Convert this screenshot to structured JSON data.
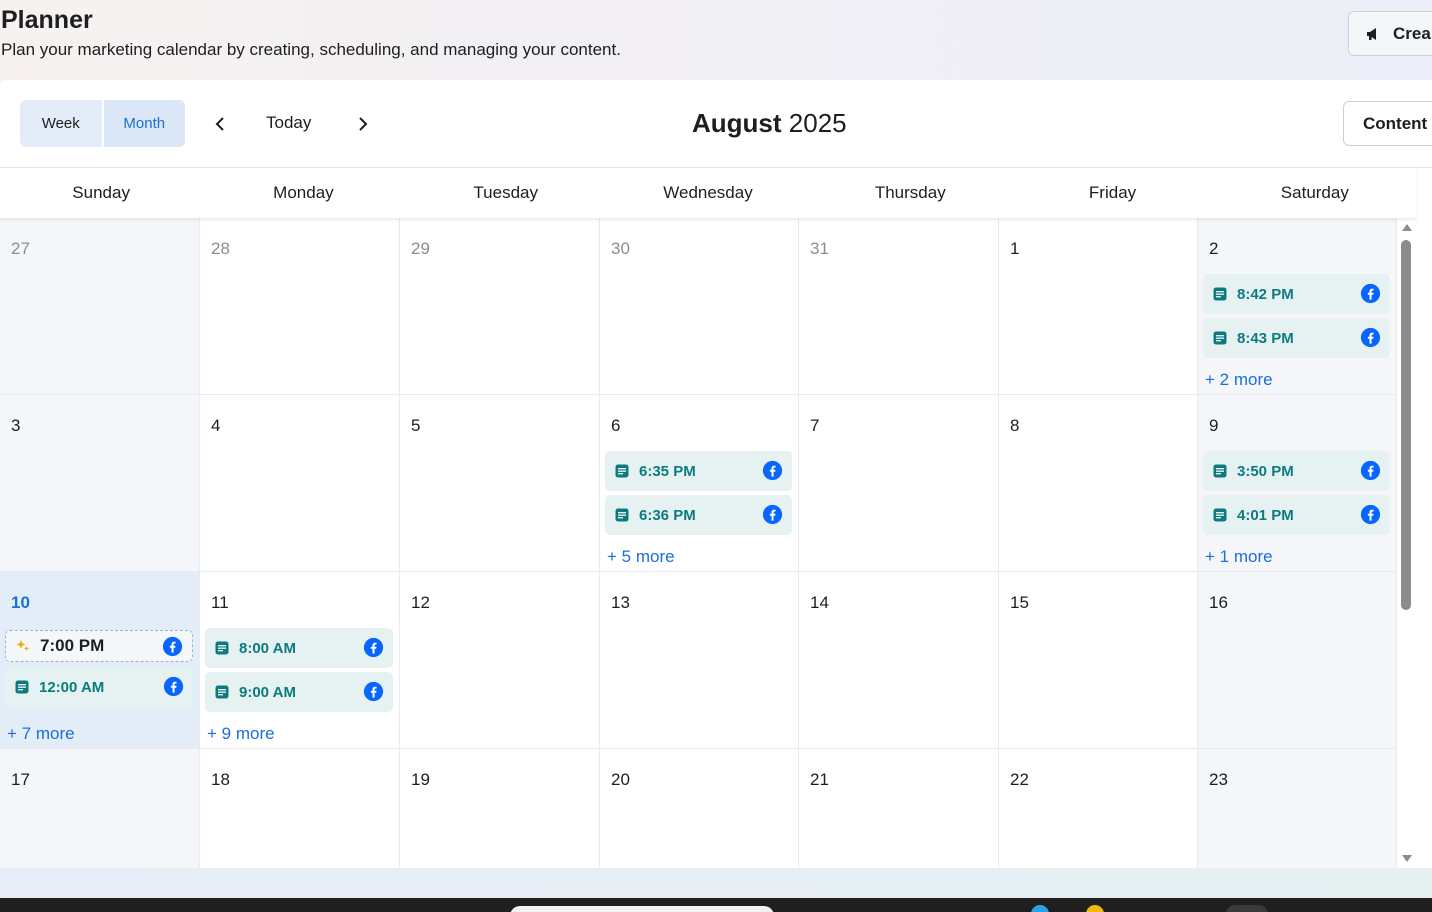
{
  "header": {
    "title": "Planner",
    "subtitle": "Plan your marketing calendar by creating, scheduling, and managing your content.",
    "create_label": "Crea"
  },
  "toolbar": {
    "view_week": "Week",
    "view_month": "Month",
    "selected_view": "Month",
    "today_label": "Today",
    "month_name": "August",
    "year": "2025",
    "content_label": "Content"
  },
  "weekdays": [
    "Sunday",
    "Monday",
    "Tuesday",
    "Wednesday",
    "Thursday",
    "Friday",
    "Saturday"
  ],
  "weeks": [
    {
      "days": [
        {
          "num": "27",
          "muted": true
        },
        {
          "num": "28",
          "muted": true
        },
        {
          "num": "29",
          "muted": true
        },
        {
          "num": "30",
          "muted": true
        },
        {
          "num": "31",
          "muted": true
        },
        {
          "num": "1"
        },
        {
          "num": "2",
          "events": [
            {
              "time": "8:42 PM"
            },
            {
              "time": "8:43 PM"
            }
          ],
          "more": "+ 2 more"
        }
      ]
    },
    {
      "days": [
        {
          "num": "3"
        },
        {
          "num": "4"
        },
        {
          "num": "5"
        },
        {
          "num": "6",
          "events": [
            {
              "time": "6:35 PM"
            },
            {
              "time": "6:36 PM"
            }
          ],
          "more": "+ 5 more"
        },
        {
          "num": "7"
        },
        {
          "num": "8"
        },
        {
          "num": "9",
          "events": [
            {
              "time": "3:50 PM"
            },
            {
              "time": "4:01 PM"
            }
          ],
          "more": "+ 1 more"
        }
      ]
    },
    {
      "days": [
        {
          "num": "10",
          "today": true,
          "events": [
            {
              "time": "7:00 PM",
              "draft": true
            },
            {
              "time": "12:00 AM"
            }
          ],
          "more": "+ 7 more"
        },
        {
          "num": "11",
          "events": [
            {
              "time": "8:00 AM"
            },
            {
              "time": "9:00 AM"
            }
          ],
          "more": "+ 9 more"
        },
        {
          "num": "12"
        },
        {
          "num": "13"
        },
        {
          "num": "14"
        },
        {
          "num": "15"
        },
        {
          "num": "16"
        }
      ]
    },
    {
      "days": [
        {
          "num": "17"
        },
        {
          "num": "18"
        },
        {
          "num": "19"
        },
        {
          "num": "20"
        },
        {
          "num": "21"
        },
        {
          "num": "22"
        },
        {
          "num": "23"
        }
      ]
    }
  ],
  "icons": {
    "facebook": "facebook-icon",
    "post": "post-icon",
    "draft": "draft-sparkle-icon",
    "megaphone": "megaphone-icon"
  },
  "colors": {
    "accent": "#1a6fd8",
    "event_text": "#0c7a7e",
    "event_bg": "#e6f2f2",
    "facebook": "#0866ff",
    "today_bg": "#e2edf8"
  }
}
